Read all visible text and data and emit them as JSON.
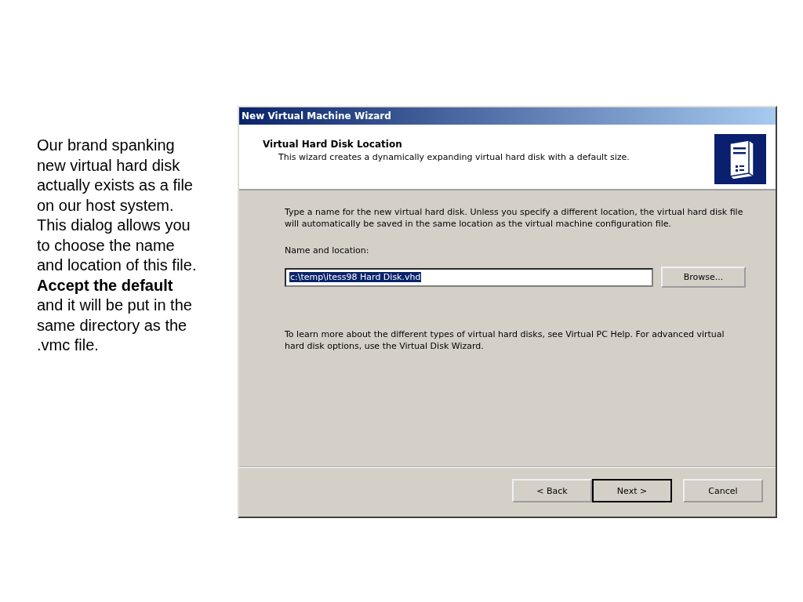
{
  "caption": "Our brand spanking new virtual hard disk actually exists as a file on our host system. This dialog allows you to choose the name and location of this file. **Accept the default** and it will be put in the same directory as the .vmc file.",
  "window": {
    "title": "New Virtual Machine Wizard"
  },
  "header": {
    "title": "Virtual Hard Disk Location",
    "subtitle": "This wizard creates a dynamically expanding virtual hard disk with a default size."
  },
  "intro": "Type a name for the new virtual hard disk. Unless you specify a different location, the virtual hard disk file will automatically be saved in the same location as the virtual machine configuration file.",
  "location_field": {
    "label": "Name and location:",
    "value": "c:\\temp\\itess98 Hard Disk.vhd",
    "selected": true
  },
  "browse_button": "Browse...",
  "help_text": "To learn more about the different types of virtual hard disks, see Virtual PC Help. For advanced virtual hard disk options, use the Virtual Disk Wizard.",
  "buttons": [
    {
      "label": "< Back",
      "default": false
    },
    {
      "label": "Next >",
      "default": true
    },
    {
      "label": "Cancel",
      "default": false
    }
  ]
}
